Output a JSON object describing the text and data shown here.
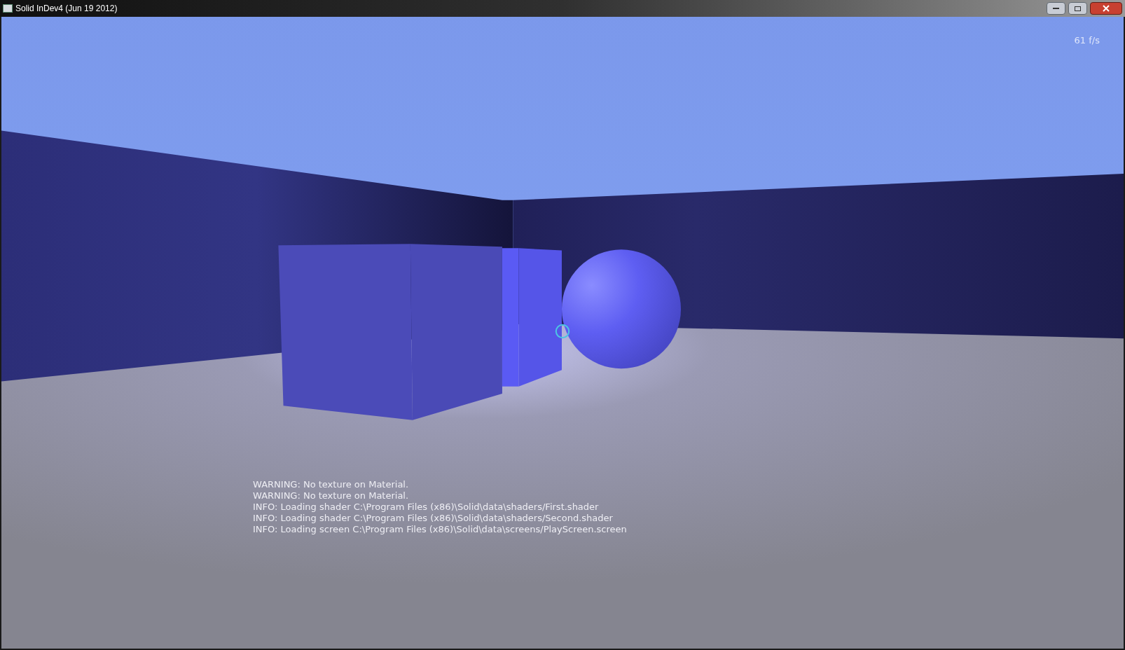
{
  "window": {
    "title": "Solid InDev4 (Jun 19 2012)"
  },
  "hud": {
    "fps": "61 f/s"
  },
  "console": {
    "lines": [
      "WARNING: No texture on Material.",
      "WARNING: No texture on Material.",
      "INFO: Loading shader C:\\Program Files (x86)\\Solid\\data\\shaders/First.shader",
      "INFO: Loading shader C:\\Program Files (x86)\\Solid\\data\\shaders/Second.shader",
      "INFO: Loading screen C:\\Program Files (x86)\\Solid\\data\\screens/PlayScreen.screen"
    ]
  }
}
